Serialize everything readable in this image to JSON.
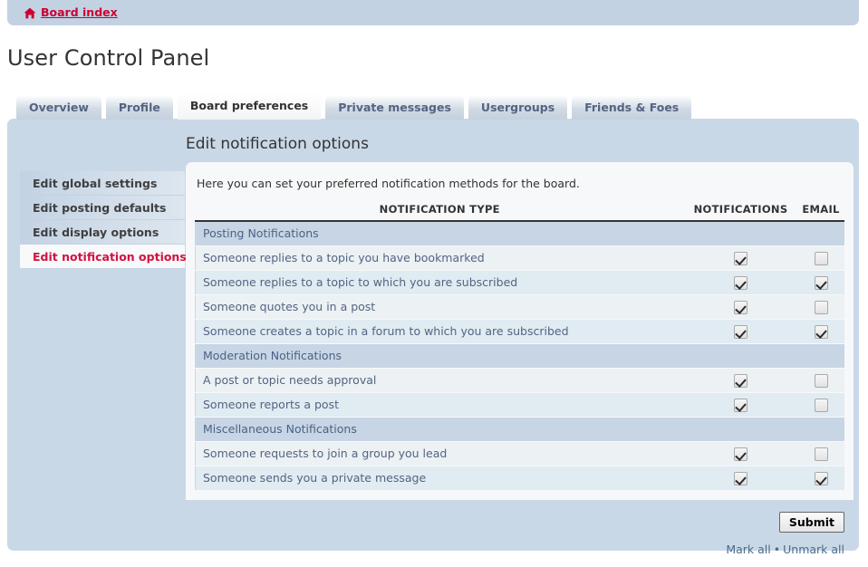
{
  "breadcrumb": {
    "home_icon": "home-icon",
    "link_label": "Board index"
  },
  "page_title": "User Control Panel",
  "tabs": [
    {
      "label": "Overview",
      "active": false
    },
    {
      "label": "Profile",
      "active": false
    },
    {
      "label": "Board preferences",
      "active": true
    },
    {
      "label": "Private messages",
      "active": false
    },
    {
      "label": "Usergroups",
      "active": false
    },
    {
      "label": "Friends & Foes",
      "active": false
    }
  ],
  "sidebar": {
    "items": [
      {
        "label": "Edit global settings",
        "active": false
      },
      {
        "label": "Edit posting defaults",
        "active": false
      },
      {
        "label": "Edit display options",
        "active": false
      },
      {
        "label": "Edit notification options",
        "active": true
      }
    ]
  },
  "main": {
    "heading": "Edit notification options",
    "description": "Here you can set your preferred notification methods for the board.",
    "table": {
      "columns": [
        "NOTIFICATION TYPE",
        "NOTIFICATIONS",
        "EMAIL"
      ],
      "rows": [
        {
          "kind": "section",
          "label": "Posting Notifications"
        },
        {
          "kind": "item",
          "label": "Someone replies to a topic you have bookmarked",
          "notifications": true,
          "email": false
        },
        {
          "kind": "item",
          "label": "Someone replies to a topic to which you are subscribed",
          "notifications": true,
          "email": true
        },
        {
          "kind": "item",
          "label": "Someone quotes you in a post",
          "notifications": true,
          "email": false
        },
        {
          "kind": "item",
          "label": "Someone creates a topic in a forum to which you are subscribed",
          "notifications": true,
          "email": true
        },
        {
          "kind": "section",
          "label": "Moderation Notifications"
        },
        {
          "kind": "item",
          "label": "A post or topic needs approval",
          "notifications": true,
          "email": false
        },
        {
          "kind": "item",
          "label": "Someone reports a post",
          "notifications": true,
          "email": false
        },
        {
          "kind": "section",
          "label": "Miscellaneous Notifications"
        },
        {
          "kind": "item",
          "label": "Someone requests to join a group you lead",
          "notifications": true,
          "email": false
        },
        {
          "kind": "item",
          "label": "Someone sends you a private message",
          "notifications": true,
          "email": true
        }
      ]
    }
  },
  "footer": {
    "submit_label": "Submit",
    "mark_all_label": "Mark all",
    "separator": "•",
    "unmark_all_label": "Unmark all"
  },
  "colors": {
    "panel_bg": "#c9d8e7",
    "breadcrumb_bg": "#c3d2e3",
    "content_bg": "#f7f8f9",
    "accent_link": "#cc0033",
    "active_nav": "#d31141",
    "text_primary": "#333333",
    "text_muted": "#536482",
    "section_row": "#c7d5e5",
    "row_odd": "#ecf1f4",
    "row_even": "#e1ebf2"
  }
}
